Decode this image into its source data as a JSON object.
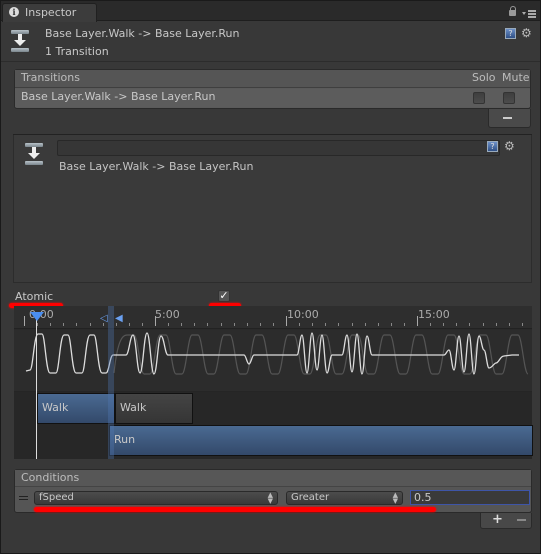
{
  "window": {
    "tab_label": "Inspector",
    "tab_icon": "info-icon",
    "controls": [
      "lock-icon",
      "tab-menu-icon"
    ]
  },
  "header": {
    "title": "Base Layer.Walk -> Base Layer.Run",
    "subtitle": "1 Transition",
    "icon": "transition-icon"
  },
  "transitions": {
    "header": "Transitions",
    "solo_label": "Solo",
    "mute_label": "Mute",
    "rows": [
      {
        "label": "Base Layer.Walk -> Base Layer.Run",
        "solo": false,
        "mute": false
      }
    ],
    "remove_label": "−"
  },
  "detail": {
    "name_value": "",
    "title": "Base Layer.Walk -> Base Layer.Run"
  },
  "atomic": {
    "label": "Atomic",
    "checked": true,
    "check_glyph": "✓"
  },
  "timeline": {
    "ticks": [
      "0:00",
      "5:00",
      "10:00",
      "15:00"
    ],
    "clips": [
      {
        "label": "Walk",
        "style": "blue"
      },
      {
        "label": "Walk",
        "style": "grey"
      },
      {
        "label": "Run",
        "style": "blue"
      }
    ]
  },
  "conditions": {
    "header": "Conditions",
    "rows": [
      {
        "parameter": "fSpeed",
        "mode": "Greater",
        "value": "0.5"
      }
    ],
    "add_label": "+",
    "remove_label": "−"
  },
  "colors": {
    "background": "#383838",
    "accent_blue": "#4a6a92",
    "highlight_red": "#ff0000",
    "focus_border": "#3e55a8"
  }
}
